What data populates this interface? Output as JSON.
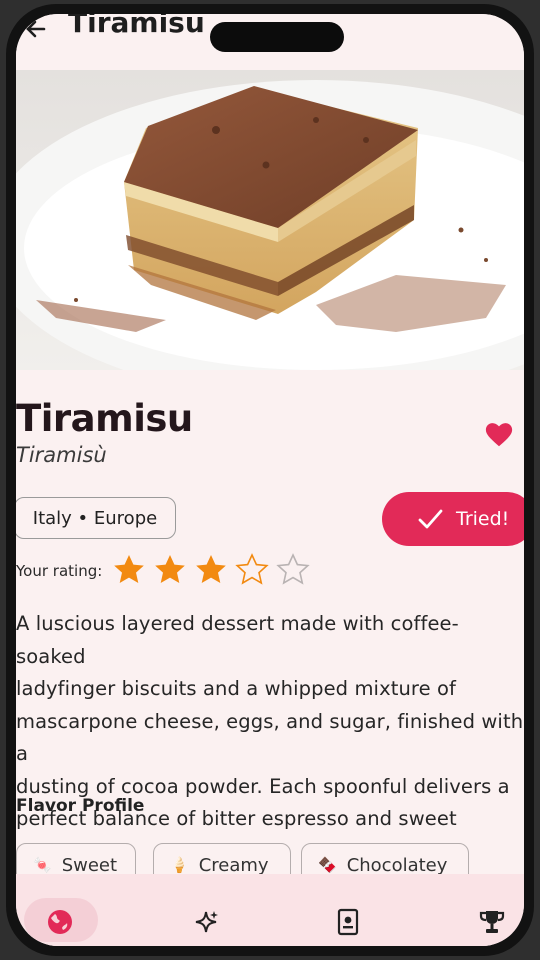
{
  "header": {
    "title": "Tiramisu"
  },
  "dish": {
    "name": "Tiramisu",
    "local_name": "Tiramisù",
    "origin": "Italy • Europe",
    "tried_label": "Tried!",
    "favorite": true,
    "rating_label": "Your rating:",
    "rating": 3,
    "rating_max": 5,
    "description": "A luscious layered dessert made with coffee-soaked\nladyfinger biscuits and a whipped mixture of\nmascarpone cheese, eggs, and sugar, finished with a\ndusting of cocoa powder. Each spoonful delivers a\nperfect balance of bitter espresso and sweet cream."
  },
  "flavor_profile": {
    "heading": "Flavor Profile",
    "chips": [
      {
        "icon": "🍬",
        "label": "Sweet"
      },
      {
        "icon": "🍦",
        "label": "Creamy"
      },
      {
        "icon": "🍫",
        "label": "Chocolatey"
      }
    ]
  },
  "nav": {
    "items": [
      {
        "icon": "globe-icon",
        "active": true
      },
      {
        "icon": "sparkle-icon",
        "active": false
      },
      {
        "icon": "passport-icon",
        "active": false
      },
      {
        "icon": "trophy-icon",
        "active": false
      }
    ]
  },
  "colors": {
    "accent": "#e22a58",
    "star": "#f28a11",
    "background": "#fbf1f1",
    "nav_background": "#fae3e6"
  }
}
